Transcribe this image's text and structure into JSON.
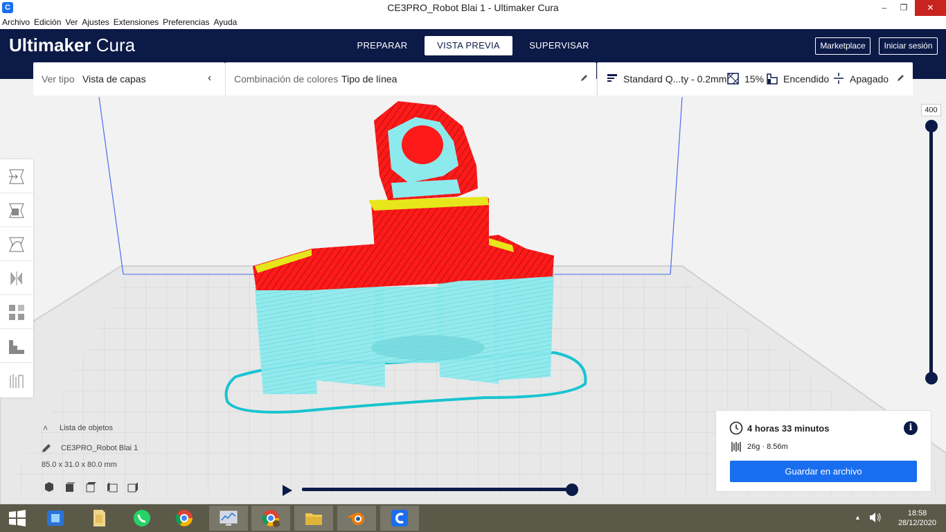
{
  "window": {
    "title": "CE3PRO_Robot Blai 1 - Ultimaker Cura",
    "app_icon_glyph": "C",
    "minimize_glyph": "–",
    "maximize_glyph": "❐",
    "close_glyph": "✕"
  },
  "menubar": [
    "Archivo",
    "Edición",
    "Ver",
    "Ajustes",
    "Extensiones",
    "Preferencias",
    "Ayuda"
  ],
  "header": {
    "logo_bold": "Ultimaker",
    "logo_light": "Cura",
    "stages": [
      "PREPARAR",
      "VISTA PREVIA",
      "SUPERVISAR"
    ],
    "active_stage": "VISTA PREVIA",
    "marketplace": "Marketplace",
    "signin": "Iniciar sesión"
  },
  "view_panel": {
    "label": "Ver tipo",
    "value": "Vista de capas",
    "color_label": "Combinación de colores",
    "color_value": "Tipo de línea"
  },
  "print_settings": {
    "profile": "Standard Q...ty - 0.2mm",
    "infill": "15%",
    "support": "Encendido",
    "adhesion": "Apagado"
  },
  "layer_slider": {
    "value": "400"
  },
  "object_list": {
    "header": "Lista de objetos",
    "object_name": "CE3PRO_Robot Blai 1",
    "dimensions": "85.0 x 31.0 x 80.0 mm"
  },
  "print_info": {
    "time": "4 horas 33 minutos",
    "material": "26g · 8.56m",
    "save_button": "Guardar en archivo"
  },
  "taskbar": {
    "time": "18:58",
    "date": "28/12/2020",
    "apps": [
      "start-icon",
      "remote-app-icon",
      "file-explorer-icon",
      "whatsapp-icon",
      "chrome-icon",
      "monitor-app-icon",
      "chrome-profile-icon",
      "folder-icon",
      "blender-icon",
      "cura-icon"
    ]
  },
  "colors": {
    "header_bg": "#0c1a47",
    "accent_blue": "#196ef0",
    "model_wall": "#ff1a1a",
    "model_support": "#7fe6ea",
    "model_skin": "#e6e61a",
    "taskbar_bg": "#5b5a49"
  }
}
